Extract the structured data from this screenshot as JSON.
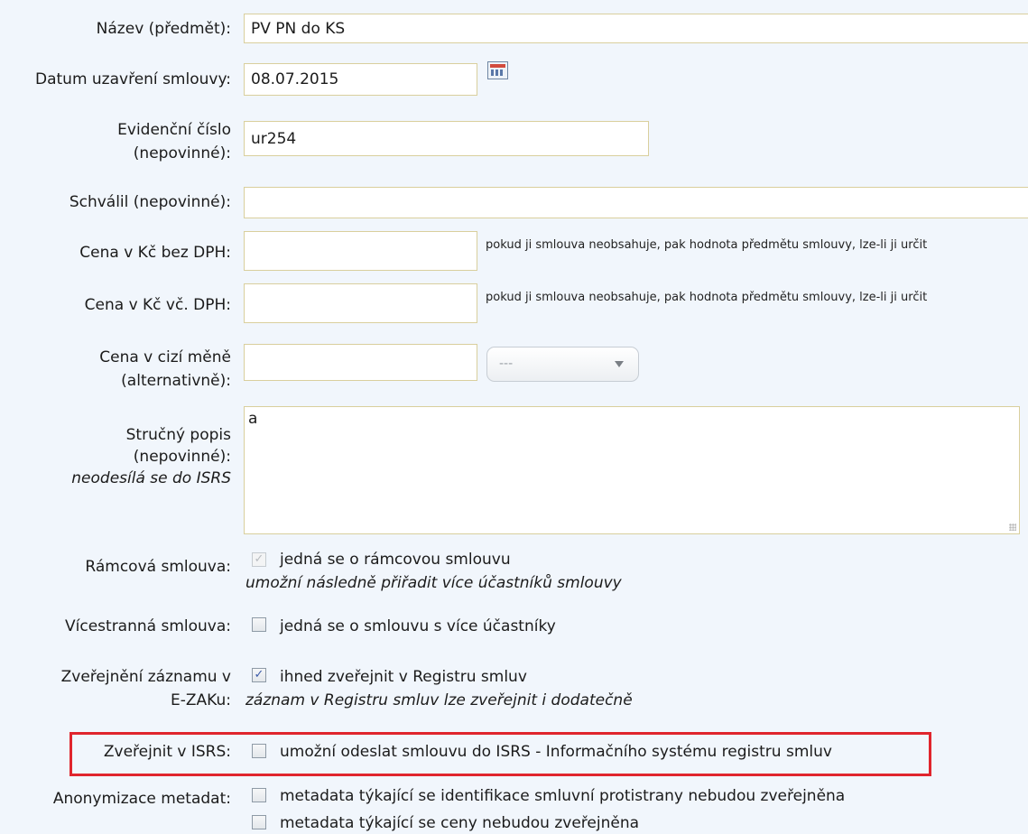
{
  "fields": {
    "nazev": {
      "label": "Název (předmět):",
      "value": "PV PN do KS"
    },
    "datum": {
      "label": "Datum uzavření smlouvy:",
      "value": "08.07.2015",
      "icon": "calendar-icon"
    },
    "evidencni": {
      "label_1": "Evidenční číslo",
      "label_2": "(nepovinné):",
      "value": "ur254"
    },
    "schvalil": {
      "label": "Schválil (nepovinné):",
      "value": ""
    },
    "cena_bez": {
      "label": "Cena v Kč bez DPH:",
      "value": "",
      "hint": "pokud ji smlouva neobsahuje, pak hodnota předmětu smlouvy, lze-li ji určit"
    },
    "cena_vc": {
      "label": "Cena v Kč vč. DPH:",
      "value": "",
      "hint": "pokud ji smlouva neobsahuje, pak hodnota předmětu smlouvy, lze-li ji určit"
    },
    "cena_cizi": {
      "label_1": "Cena v cizí měně",
      "label_2": "(alternativně):",
      "value": "",
      "currency_selected": "---"
    },
    "popis": {
      "label_1": "Stručný popis",
      "label_2": "(nepovinné):",
      "label_3": "neodesílá se do ISRS",
      "value": "a"
    }
  },
  "options": {
    "ramcova": {
      "label": "Rámcová smlouva:",
      "text": "jedná se o rámcovou smlouvu",
      "subtext": "umožní následně přiřadit více účastníků smlouvy",
      "checked": true,
      "disabled": true
    },
    "vicestranna": {
      "label": "Vícestranná smlouva:",
      "text": "jedná se o smlouvu s více účastníky",
      "checked": false
    },
    "zverejneni": {
      "label_1": "Zveřejnění záznamu v",
      "label_2": "E-ZAKu:",
      "text": "ihned zveřejnit v Registru smluv",
      "subtext": "záznam v Registru smluv lze zveřejnit i dodatečně",
      "checked": true
    },
    "isrs": {
      "label": "Zveřejnit v ISRS:",
      "text": "umožní odeslat smlouvu do ISRS - Informačního systému registru smluv",
      "checked": false
    },
    "anonymizace": {
      "label": "Anonymizace metadat:",
      "text_1": "metadata týkající se identifikace smluvní protistrany nebudou zveřejněna",
      "text_2": "metadata týkající se ceny nebudou zveřejněna",
      "checked_1": false,
      "checked_2": false
    }
  },
  "colors": {
    "background": "#f1f6fc",
    "input_border": "#d9cf9d",
    "highlight": "#e0252d"
  }
}
